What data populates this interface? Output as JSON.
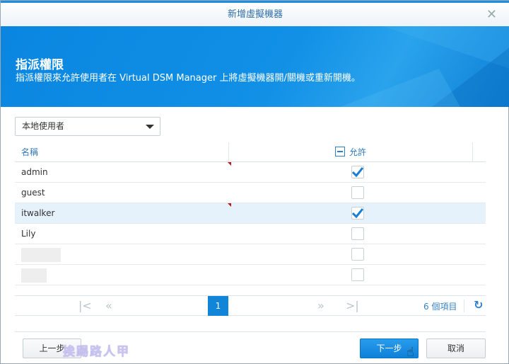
{
  "window": {
    "title": "新增虛擬機器"
  },
  "banner": {
    "title": "指派權限",
    "description": "指派權限來允許使用者在 Virtual DSM Manager 上將虛擬機器開/關機或重新開機。"
  },
  "filter": {
    "selected": "本地使用者"
  },
  "table": {
    "headers": {
      "name": "名稱",
      "allow": "允許"
    },
    "rows": [
      {
        "name": "admin",
        "allowed": true
      },
      {
        "name": "guest",
        "allowed": false
      },
      {
        "name": "itwalker",
        "allowed": true,
        "selected": true
      },
      {
        "name": "Lily",
        "allowed": false
      },
      {
        "name": "",
        "allowed": false
      },
      {
        "name": "",
        "allowed": false
      }
    ]
  },
  "pager": {
    "page": "1",
    "count": "6 個項目"
  },
  "buttons": {
    "back": "上一步",
    "next": "下一步",
    "cancel": "取消"
  },
  "watermark": "挨踢路人甲",
  "colors": {
    "accent": "#1186d8"
  }
}
